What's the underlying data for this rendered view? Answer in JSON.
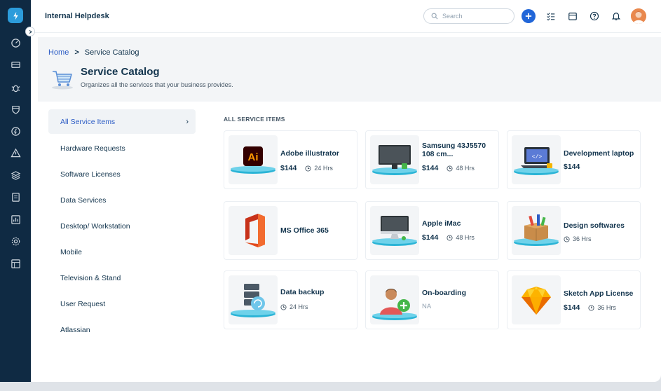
{
  "header": {
    "app_title": "Internal Helpdesk",
    "search_placeholder": "Search"
  },
  "breadcrumb": {
    "home": "Home",
    "separator": ">",
    "current": "Service Catalog"
  },
  "page": {
    "title": "Service Catalog",
    "subtitle": "Organizes all the services that your business provides."
  },
  "categories": [
    {
      "label": "All Service Items",
      "active": true
    },
    {
      "label": "Hardware Requests"
    },
    {
      "label": "Software Licenses"
    },
    {
      "label": "Data Services"
    },
    {
      "label": "Desktop/ Workstation"
    },
    {
      "label": "Mobile"
    },
    {
      "label": "Television & Stand"
    },
    {
      "label": "User Request"
    },
    {
      "label": "Atlassian"
    }
  ],
  "section_label": "ALL SERVICE ITEMS",
  "items": [
    {
      "name": "Adobe illustrator",
      "price": "$144",
      "eta": "24 Hrs",
      "icon": "illustrator-icon"
    },
    {
      "name": "Samsung 43J5570 108 cm...",
      "price": "$144",
      "eta": "48 Hrs",
      "icon": "monitor-icon"
    },
    {
      "name": "Development laptop",
      "price": "$144",
      "icon": "laptop-icon"
    },
    {
      "name": "MS Office 365",
      "icon": "office-icon"
    },
    {
      "name": "Apple iMac",
      "price": "$144",
      "eta": "48 Hrs",
      "icon": "imac-icon"
    },
    {
      "name": "Design softwares",
      "eta": "36 Hrs",
      "icon": "design-box-icon"
    },
    {
      "name": "Data backup",
      "eta": "24 Hrs",
      "icon": "data-backup-icon"
    },
    {
      "name": "On-boarding",
      "note": "NA",
      "icon": "onboarding-user-icon"
    },
    {
      "name": "Sketch App License",
      "price": "$144",
      "eta": "36 Hrs",
      "icon": "sketch-icon"
    }
  ],
  "colors": {
    "sidebar": "#0f2a43",
    "accent": "#2c5cc5",
    "primary_button": "#2166d8",
    "platform_teal": "#2bb4d6"
  }
}
